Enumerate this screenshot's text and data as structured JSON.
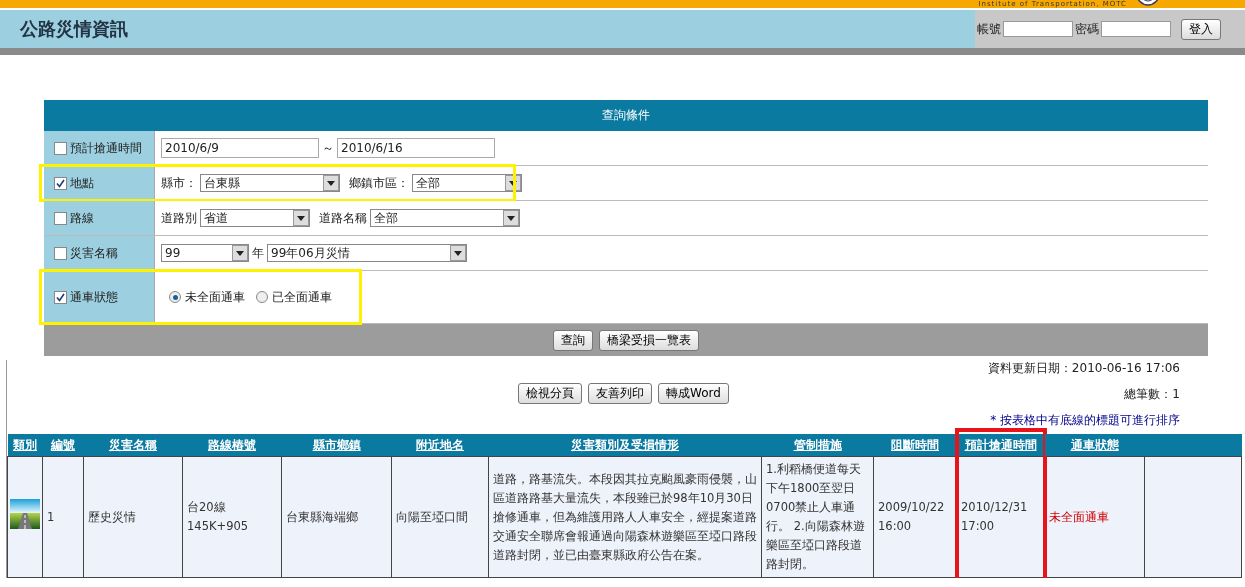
{
  "header": {
    "org_caption": "Institute of Transportation, MOTC",
    "title": "公路災情資訊",
    "login": {
      "account_label": "帳號",
      "password_label": "密碼",
      "button": "登入"
    }
  },
  "query": {
    "title": "查詢條件",
    "rows": [
      {
        "kind": "date_range",
        "label": "預計搶通時間",
        "checked": false,
        "highlighted": false,
        "from": "2010/6/9",
        "separator": "～",
        "to": "2010/6/16"
      },
      {
        "kind": "selects",
        "label": "地點",
        "checked": true,
        "highlighted": true,
        "fields": [
          {
            "label": "縣市：",
            "value": "台東縣"
          },
          {
            "label": "鄉鎮市區：",
            "value": "全部"
          }
        ]
      },
      {
        "kind": "selects",
        "label": "路線",
        "checked": false,
        "highlighted": false,
        "fields": [
          {
            "label": "道路別",
            "value": "省道"
          },
          {
            "label": "道路名稱",
            "value": "全部"
          }
        ]
      },
      {
        "kind": "selects",
        "label": "災害名稱",
        "checked": false,
        "highlighted": false,
        "fields": [
          {
            "value": "99",
            "suffix": "年"
          },
          {
            "value": "99年06月災情"
          }
        ]
      },
      {
        "kind": "radios",
        "label": "通車狀態",
        "checked": true,
        "highlighted": true,
        "options": [
          {
            "label": "未全面通車",
            "selected": true
          },
          {
            "label": "已全面通車",
            "selected": false
          }
        ]
      }
    ],
    "buttons": [
      "查詢",
      "橋梁受損一覽表"
    ]
  },
  "results": {
    "updated": "資料更新日期：2010-06-16 17:06",
    "actions": [
      "檢視分頁",
      "友善列印",
      "轉成Word"
    ],
    "total": "總筆數：1",
    "sort_hint": "* 按表格中有底線的標題可進行排序",
    "columns": [
      {
        "label": "類別",
        "highlighted": false
      },
      {
        "label": "編號",
        "highlighted": false
      },
      {
        "label": "災害名稱",
        "highlighted": false
      },
      {
        "label": "路線樁號",
        "highlighted": false
      },
      {
        "label": "縣市鄉鎮",
        "highlighted": false
      },
      {
        "label": "附近地名",
        "highlighted": false
      },
      {
        "label": "災害類別及受損情形",
        "highlighted": false
      },
      {
        "label": "管制措施",
        "highlighted": false
      },
      {
        "label": "阻斷時間",
        "highlighted": false
      },
      {
        "label": "預計搶通時間",
        "highlighted": true
      },
      {
        "label": "通車狀態",
        "highlighted": false
      }
    ],
    "rows": [
      {
        "cells": [
          {
            "kind": "icon"
          },
          {
            "kind": "text",
            "text": "1"
          },
          {
            "kind": "text",
            "text": "歷史災情"
          },
          {
            "kind": "lines",
            "lines": [
              "台20線",
              "145K+905"
            ]
          },
          {
            "kind": "text",
            "text": "台東縣海端鄉"
          },
          {
            "kind": "text",
            "text": "向陽至埡口間"
          },
          {
            "kind": "text",
            "text": "道路，路基流失。本段因其拉克颱風豪雨侵襲，山區道路路基大量流失，本段雖已於98年10月30日搶修通車，但為維護用路人人車安全，經提案道路交通安全聯席會報通過向陽森林遊樂區至埡口路段道路封閉，並已由臺東縣政府公告在案。"
          },
          {
            "kind": "text",
            "text": "1.利稻橋便道每天下午1800至翌日0700禁止人車通行。 2.向陽森林遊樂區至埡口路段道路封閉。"
          },
          {
            "kind": "lines",
            "lines": [
              "2009/10/22",
              "16:00"
            ]
          },
          {
            "kind": "lines",
            "lines": [
              "2010/12/31",
              "17:00"
            ]
          },
          {
            "kind": "status",
            "text": "未全面通車"
          },
          {
            "kind": "empty"
          }
        ]
      }
    ]
  }
}
